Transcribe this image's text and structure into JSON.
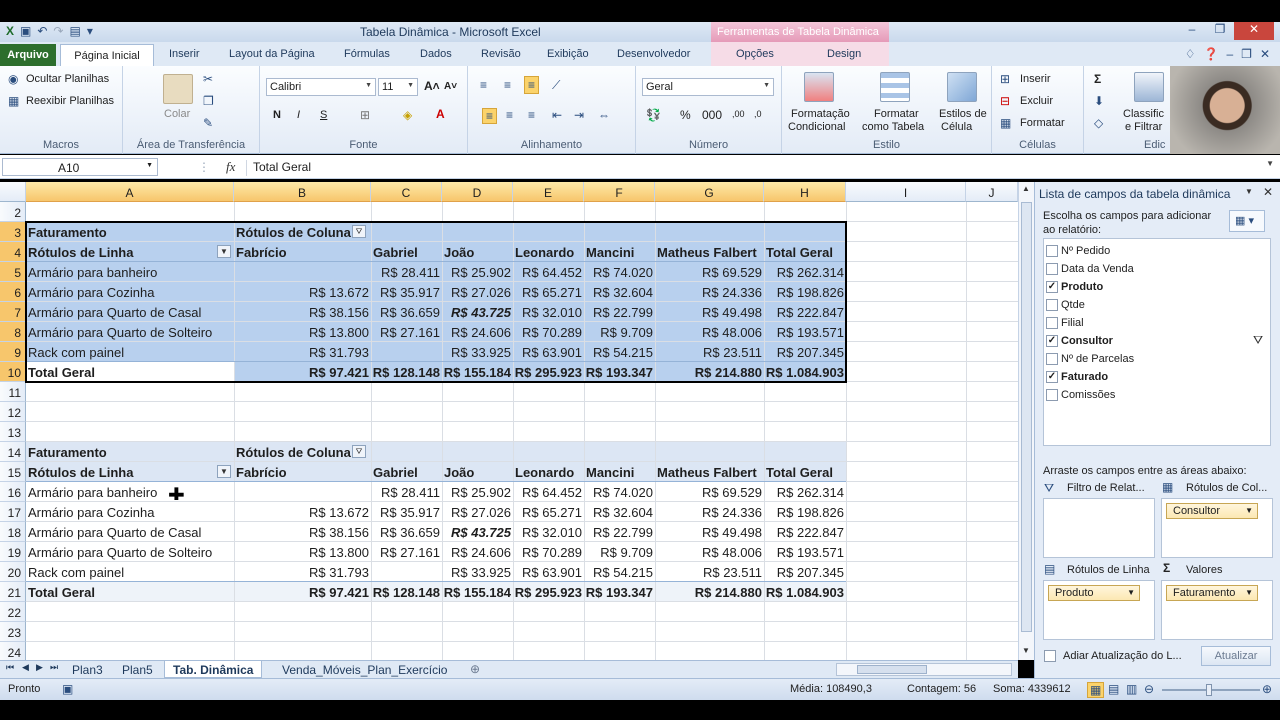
{
  "window": {
    "title": "Tabela Dinâmica - Microsoft Excel",
    "context_group": "Ferramentas de Tabela Dinâmica"
  },
  "ribbon_tabs": [
    "Arquivo",
    "Página Inicial",
    "Inserir",
    "Layout da Página",
    "Fórmulas",
    "Dados",
    "Revisão",
    "Exibição",
    "Desenvolvedor",
    "Opções",
    "Design"
  ],
  "ribbon": {
    "macros": {
      "hide_sheets": "Ocultar Planilhas",
      "show_sheets": "Reexibir Planilhas",
      "label": "Macros"
    },
    "clipboard": {
      "paste": "Colar",
      "label": "Área de Transferência"
    },
    "font": {
      "name": "Calibri",
      "size": "11",
      "bold": "N",
      "italic": "I",
      "underline": "S",
      "label": "Fonte"
    },
    "alignment": {
      "label": "Alinhamento"
    },
    "number": {
      "format": "Geral",
      "label": "Número"
    },
    "styles": {
      "cond_format": "Formatação",
      "cond_format2": "Condicional",
      "as_table": "Formatar",
      "as_table2": "como Tabela",
      "cell_styles": "Estilos de",
      "cell_styles2": "Célula",
      "label": "Estilo"
    },
    "cells": {
      "insert": "Inserir",
      "delete": "Excluir",
      "format": "Formatar",
      "label": "Células"
    },
    "editing": {
      "sort": "Classific",
      "sort2": "e Filtrar",
      "label": "Edic"
    }
  },
  "formula_bar": {
    "name_box": "A10",
    "fx": "fx",
    "value": "Total Geral"
  },
  "columns": [
    "A",
    "B",
    "C",
    "D",
    "E",
    "F",
    "G",
    "H",
    "I",
    "J"
  ],
  "rows": [
    "2",
    "3",
    "4",
    "5",
    "6",
    "7",
    "8",
    "9",
    "10",
    "11",
    "12",
    "13",
    "14",
    "15",
    "16",
    "17",
    "18",
    "19",
    "20",
    "21",
    "22",
    "23",
    "24"
  ],
  "pivot": {
    "values_label": "Faturamento",
    "col_labels": "Rótulos de Coluna",
    "row_labels": "Rótulos de Linha",
    "headers": [
      "Fabrício",
      "Gabriel",
      "João",
      "Leonardo",
      "Mancini",
      "Matheus Falbert",
      "Total Geral"
    ],
    "items": [
      {
        "name": "Armário para banheiro",
        "v": [
          "",
          "R$ 28.411",
          "R$ 25.902",
          "R$ 64.452",
          "R$ 74.020",
          "R$ 69.529",
          "R$ 262.314"
        ]
      },
      {
        "name": "Armário para Cozinha",
        "v": [
          "R$ 13.672",
          "R$ 35.917",
          "R$ 27.026",
          "R$ 65.271",
          "R$ 32.604",
          "R$ 24.336",
          "R$ 198.826"
        ]
      },
      {
        "name": "Armário para Quarto de Casal",
        "v": [
          "R$ 38.156",
          "R$ 36.659",
          "R$ 43.725",
          "R$ 32.010",
          "R$ 22.799",
          "R$ 49.498",
          "R$ 222.847"
        ]
      },
      {
        "name": "Armário para Quarto de Solteiro",
        "v": [
          "R$ 13.800",
          "R$ 27.161",
          "R$ 24.606",
          "R$ 70.289",
          "R$ 9.709",
          "R$ 48.006",
          "R$ 193.571"
        ]
      },
      {
        "name": "Rack com painel",
        "v": [
          "R$ 31.793",
          "",
          "R$ 33.925",
          "R$ 63.901",
          "R$ 54.215",
          "R$ 23.511",
          "R$ 207.345"
        ]
      }
    ],
    "total": {
      "name": "Total Geral",
      "v": [
        "R$ 97.421",
        "R$ 128.148",
        "R$ 155.184",
        "R$ 295.923",
        "R$ 193.347",
        "R$ 214.880",
        "R$ 1.084.903"
      ]
    }
  },
  "sheet_tabs": [
    "Plan3",
    "Plan5",
    "Tab. Dinâmica",
    "Venda_Móveis_Plan_Exercício"
  ],
  "status": {
    "mode": "Pronto",
    "average": "Média: 108490,3",
    "count": "Contagem: 56",
    "sum": "Soma: 4339612"
  },
  "field_list": {
    "title": "Lista de campos da tabela dinâmica",
    "choose": "Escolha os campos para adicionar ao relatório:",
    "fields": [
      {
        "name": "Nº Pedido",
        "checked": false
      },
      {
        "name": "Data da Venda",
        "checked": false
      },
      {
        "name": "Produto",
        "checked": true
      },
      {
        "name": "Qtde",
        "checked": false
      },
      {
        "name": "Filial",
        "checked": false
      },
      {
        "name": "Consultor",
        "checked": true
      },
      {
        "name": "Nº de Parcelas",
        "checked": false
      },
      {
        "name": "Faturado",
        "checked": true
      },
      {
        "name": "Comissões",
        "checked": false
      }
    ],
    "drag": "Arraste os campos entre as áreas abaixo:",
    "report_filter": "Filtro de Relat...",
    "col_labels": "Rótulos de Col...",
    "row_labels": "Rótulos de Linha",
    "values": "Valores",
    "col_pill": "Consultor",
    "row_pill": "Produto",
    "val_pill": "Faturamento",
    "defer": "Adiar Atualização do L...",
    "update": "Atualizar"
  }
}
